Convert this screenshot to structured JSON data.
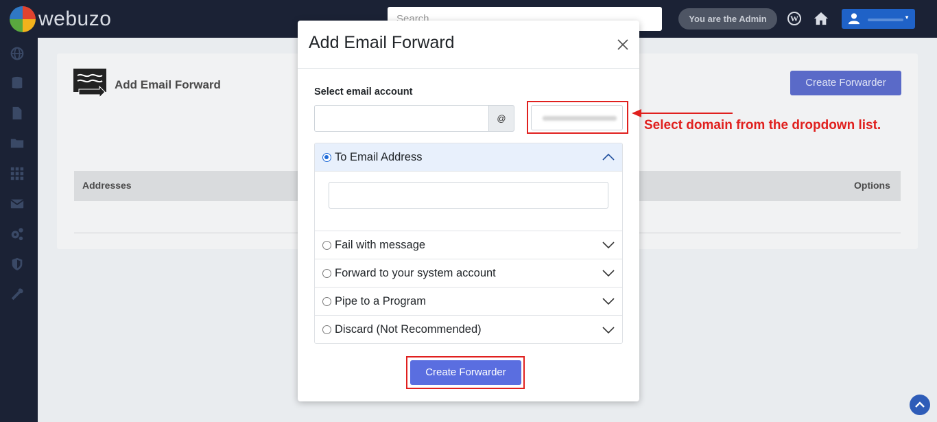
{
  "header": {
    "logo_text": "webuzo",
    "search_placeholder": "Search...",
    "admin_label": "You are the Admin",
    "wp_glyph": "W"
  },
  "sidebar": {
    "icons": [
      "globe-icon",
      "database-icon",
      "file-icon",
      "folder-icon",
      "grid-icon",
      "mail-icon",
      "gears-icon",
      "shield-icon",
      "wrench-icon"
    ]
  },
  "page": {
    "title": "Add Email Forward",
    "create_button": "Create Forwarder",
    "table": {
      "columns": [
        "Addresses",
        "Options"
      ]
    }
  },
  "modal": {
    "title": "Add Email Forward",
    "select_label": "Select email account",
    "at_symbol": "@",
    "email_value": "",
    "options": [
      {
        "label": "To Email Address",
        "selected": true,
        "expanded": true
      },
      {
        "label": "Fail with message",
        "selected": false,
        "expanded": false
      },
      {
        "label": "Forward to your system account",
        "selected": false,
        "expanded": false
      },
      {
        "label": "Pipe to a Program",
        "selected": false,
        "expanded": false
      },
      {
        "label": "Discard (Not Recommended)",
        "selected": false,
        "expanded": false
      }
    ],
    "submit_label": "Create Forwarder"
  },
  "annotation": {
    "text": "Select domain from the dropdown list.",
    "color": "#e0201e"
  },
  "colors": {
    "header_bg": "#1b2235",
    "primary": "#5a6ee0",
    "highlight": "#e0201e"
  }
}
